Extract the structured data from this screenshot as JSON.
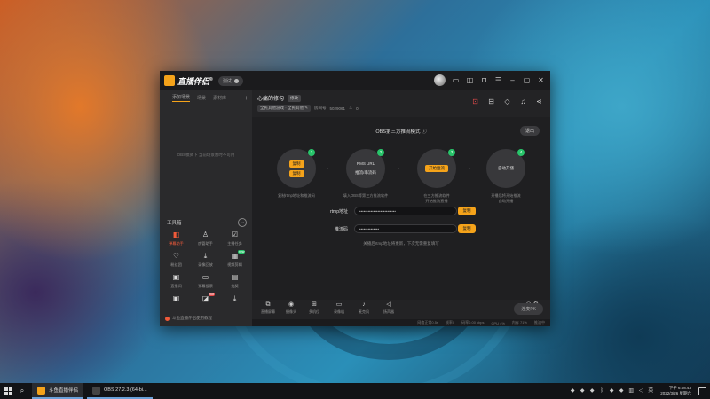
{
  "app": {
    "title": "直播伴侣",
    "title_sup": "®",
    "version_label": "测试",
    "accent": "#f5a31a"
  },
  "left": {
    "tabs": [
      "添加场景",
      "场景",
      "素材库"
    ],
    "empty_text": "OBS模式下 当前场景暂时不可用",
    "toolbox_title": "工具箱",
    "tools": [
      {
        "label": "弹幕助手",
        "icon": "danmaku-icon",
        "glyph": "◧",
        "hot": true
      },
      {
        "label": "房管助手",
        "icon": "user-manage-icon",
        "glyph": "♙"
      },
      {
        "label": "主播任务",
        "icon": "task-icon",
        "glyph": "☑"
      },
      {
        "label": "粉丝团",
        "icon": "fans-icon",
        "glyph": "♡"
      },
      {
        "label": "录像回放",
        "icon": "download-icon",
        "glyph": "⤓"
      },
      {
        "label": "视频剪辑",
        "icon": "clip-icon",
        "glyph": "▦",
        "badge": "new"
      },
      {
        "label": "直播间",
        "icon": "live-room-icon",
        "glyph": "▣"
      },
      {
        "label": "弹幕投票",
        "icon": "vote-icon",
        "glyph": "▭"
      },
      {
        "label": "抽奖",
        "icon": "lottery-icon",
        "glyph": "▤"
      },
      {
        "label": "",
        "icon": "more-tool-icon-a",
        "glyph": "▣"
      },
      {
        "label": "",
        "icon": "more-tool-icon-b",
        "glyph": "◪",
        "badge": "hot"
      },
      {
        "label": "",
        "icon": "more-tool-icon-c",
        "glyph": "⤓"
      }
    ],
    "bottom_text": "斗鱼直播伴侣使用教程"
  },
  "room": {
    "title": "心痛的修勾",
    "modify_label": "修改",
    "category": "全民其他游戏 · 全民其他",
    "room_id_label": "房间号",
    "room_id": "5029061",
    "popularity": "0"
  },
  "main": {
    "obs_title": "OBS第三方推流模式",
    "exit_label": "退出",
    "steps": [
      {
        "num": "1",
        "chips": [
          "复制",
          "复制"
        ],
        "desc": "复制rtmp地址和推流码"
      },
      {
        "num": "2",
        "chips": [
          "RMS URL",
          "推流/串流码"
        ],
        "desc": "填入OBS等第三方推流软件"
      },
      {
        "num": "3",
        "chips": [
          "开始推流"
        ],
        "desc": "在三方推流软件\n开始推流直播"
      },
      {
        "num": "4",
        "chips": [
          "自动开播"
        ],
        "desc": "开播后将开始推流\n自动开播"
      }
    ],
    "rtmp_label": "rtmp地址",
    "rtmp_value": "••••••••••••••••••••••••••",
    "key_label": "推流码",
    "key_value": "••••••••••••••",
    "copy_label": "复制",
    "hint": "关播后rtmp地址将更新，下次无需重复填写"
  },
  "controls": {
    "items": [
      {
        "label": "直播屏幕",
        "icon": "screen-icon",
        "glyph": "⧉"
      },
      {
        "label": "摄像头",
        "icon": "camera-icon",
        "glyph": "◉"
      },
      {
        "label": "多机位",
        "icon": "multi-cam-icon",
        "glyph": "⊞"
      },
      {
        "label": "录像机",
        "icon": "recorder-icon",
        "glyph": "▭"
      },
      {
        "label": "麦克风",
        "icon": "mic-icon",
        "glyph": "♪"
      },
      {
        "label": "扬声器",
        "icon": "speaker-icon",
        "glyph": "◁"
      }
    ],
    "live_label": "连麦PK"
  },
  "status": {
    "items": [
      "网络正常0.5s",
      "帧率0",
      "码率0.00 kbps",
      "CPU 4%",
      "内存 71%",
      "推流中"
    ]
  },
  "taskbar": {
    "tasks": [
      {
        "label": "斗鱼直播伴侣",
        "color": "#f5a31a",
        "active": true
      },
      {
        "label": "OBS 27.2.3 (64-bi...",
        "color": "#444444",
        "active": false
      }
    ],
    "time": "下午 6:08:43",
    "date": "2022/3/26 星期六"
  }
}
